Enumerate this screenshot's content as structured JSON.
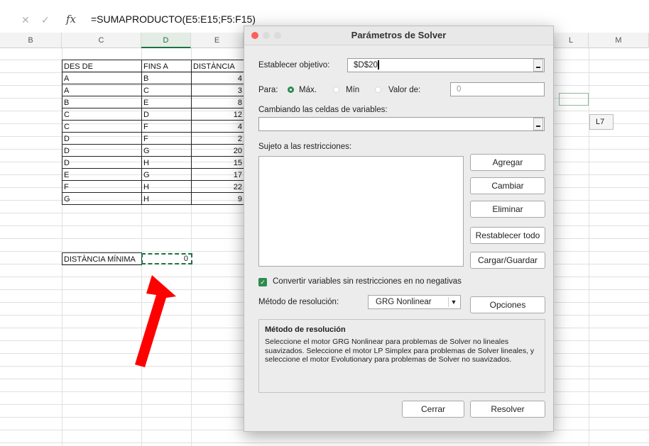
{
  "formula_bar": {
    "cancel_glyph": "✕",
    "confirm_glyph": "✓",
    "fx_label": "fx",
    "formula": "=SUMAPRODUCTO(E5:E15;F5:F15)"
  },
  "columns": [
    "B",
    "C",
    "D",
    "E",
    "L",
    "M"
  ],
  "table": {
    "headers": [
      "DES DE",
      "FINS A",
      "DISTÀNCIA"
    ],
    "rows": [
      [
        "A",
        "B",
        "4"
      ],
      [
        "A",
        "C",
        "3"
      ],
      [
        "B",
        "E",
        "8"
      ],
      [
        "C",
        "D",
        "12"
      ],
      [
        "C",
        "F",
        "4"
      ],
      [
        "D",
        "F",
        "2"
      ],
      [
        "D",
        "G",
        "20"
      ],
      [
        "D",
        "H",
        "15"
      ],
      [
        "E",
        "G",
        "17"
      ],
      [
        "F",
        "H",
        "22"
      ],
      [
        "G",
        "H",
        "9"
      ]
    ]
  },
  "min_distance": {
    "label": "DISTÀNCIA MÍNIMA",
    "value": "0"
  },
  "ref_tooltip": "L7",
  "arrow_color": "#ff0000",
  "dialog": {
    "title": "Parámetros de Solver",
    "objective_label": "Establecer objetivo:",
    "objective_value": "$D$20",
    "to_label": "Para:",
    "max_label": "Máx.",
    "min_label": "Mín",
    "value_of_label": "Valor de:",
    "value_of_value": "0",
    "changing_label": "Cambiando las celdas de variables:",
    "changing_value": "",
    "constraints_label": "Sujeto a las restricciones:",
    "btn_add": "Agregar",
    "btn_change": "Cambiar",
    "btn_delete": "Eliminar",
    "btn_reset": "Restablecer todo",
    "btn_load_save": "Cargar/Guardar",
    "nonneg_label": "Convertir variables sin restricciones en no negativas",
    "method_label": "Método de resolución:",
    "method_value": "GRG Nonlinear",
    "btn_options": "Opciones",
    "desc_title": "Método de resolución",
    "desc_text": "Seleccione el motor GRG Nonlinear para problemas de Solver no lineales suavizados. Seleccione el motor LP Simplex para problemas de Solver lineales, y seleccione el motor Evolutionary para problemas de Solver no suavizados.",
    "btn_close": "Cerrar",
    "btn_solve": "Resolver",
    "accent_color": "#2e8b4f"
  }
}
